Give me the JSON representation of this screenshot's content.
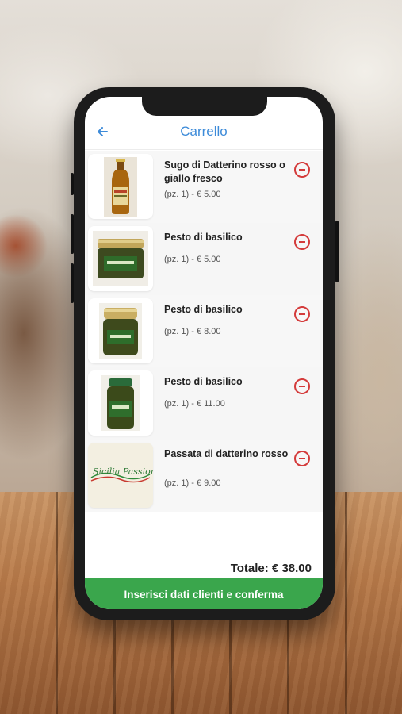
{
  "header": {
    "back_icon": "arrow-left-icon",
    "title": "Carrello"
  },
  "cart": {
    "items": [
      {
        "name": "Sugo di Datterino rosso o giallo fresco",
        "detail": "(pz. 1) - € 5.00"
      },
      {
        "name": "Pesto di basilico",
        "detail": "(pz. 1) - € 5.00"
      },
      {
        "name": "Pesto di basilico",
        "detail": "(pz. 1) - € 8.00"
      },
      {
        "name": "Pesto di basilico",
        "detail": "(pz. 1) - € 11.00"
      },
      {
        "name": "Passata di datterino rosso",
        "detail": "(pz. 1) - € 9.00"
      }
    ],
    "logo_text": "Sicilia Passion",
    "total": "Totale: € 38.00"
  },
  "footer": {
    "confirm_label": "Inserisci dati clienti e conferma"
  },
  "colors": {
    "accent": "#3d8bd9",
    "confirm": "#3aa64c",
    "remove": "#d43b3b"
  }
}
